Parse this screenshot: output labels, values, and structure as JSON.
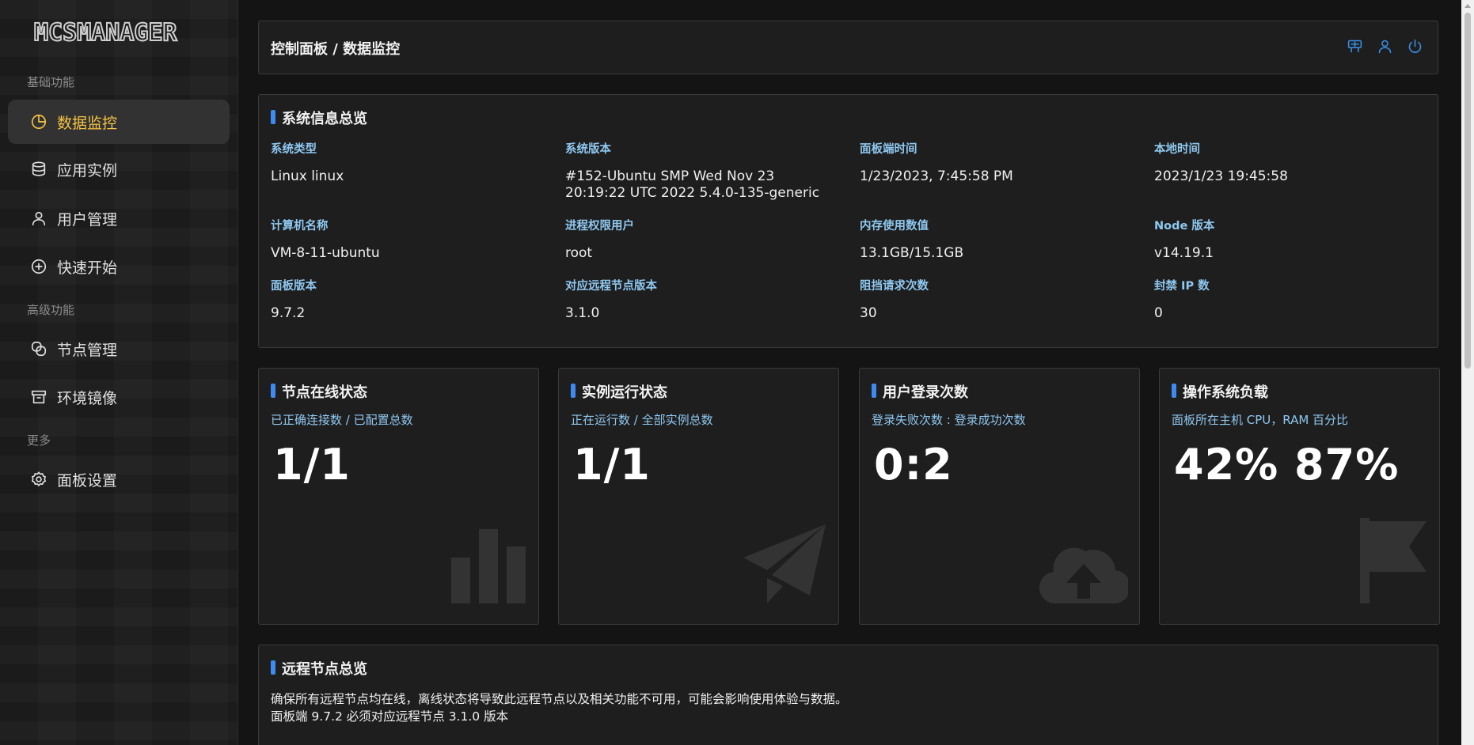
{
  "logo": "MCSMANAGER",
  "sidebar": {
    "groups": [
      {
        "title": "基础功能"
      },
      {
        "title": "高级功能"
      },
      {
        "title": "更多"
      }
    ],
    "items": [
      {
        "label": "数据监控",
        "icon": "pie-chart-icon",
        "active": true
      },
      {
        "label": "应用实例",
        "icon": "database-icon"
      },
      {
        "label": "用户管理",
        "icon": "user-icon"
      },
      {
        "label": "快速开始",
        "icon": "plus-circle-icon"
      },
      {
        "label": "节点管理",
        "icon": "node-link-icon"
      },
      {
        "label": "环境镜像",
        "icon": "archive-box-icon"
      },
      {
        "label": "面板设置",
        "icon": "gear-icon"
      }
    ]
  },
  "header": {
    "breadcrumb": "控制面板 / 数据监控",
    "icons": [
      "translate-icon",
      "user-icon",
      "power-icon"
    ]
  },
  "system": {
    "title": "系统信息总览",
    "fields": [
      {
        "label": "系统类型",
        "value": "Linux linux"
      },
      {
        "label": "系统版本",
        "value": "#152-Ubuntu SMP Wed Nov 23 20:19:22 UTC 2022 5.4.0-135-generic"
      },
      {
        "label": "面板端时间",
        "value": "1/23/2023, 7:45:58 PM"
      },
      {
        "label": "本地时间",
        "value": "2023/1/23 19:45:58"
      },
      {
        "label": "计算机名称",
        "value": "VM-8-11-ubuntu"
      },
      {
        "label": "进程权限用户",
        "value": "root"
      },
      {
        "label": "内存使用数值",
        "value": "13.1GB/15.1GB"
      },
      {
        "label": "Node 版本",
        "value": "v14.19.1"
      },
      {
        "label": "面板版本",
        "value": "9.7.2"
      },
      {
        "label": "对应远程节点版本",
        "value": "3.1.0"
      },
      {
        "label": "阻挡请求次数",
        "value": "30"
      },
      {
        "label": "封禁 IP 数",
        "value": "0"
      }
    ]
  },
  "stats": [
    {
      "title": "节点在线状态",
      "subtitle": "已正确连接数 / 已配置总数",
      "value": "1/1",
      "icon": "bar-chart-icon"
    },
    {
      "title": "实例运行状态",
      "subtitle": "正在运行数 / 全部实例总数",
      "value": "1/1",
      "icon": "paper-plane-icon"
    },
    {
      "title": "用户登录次数",
      "subtitle": "登录失败次数 : 登录成功次数",
      "value": "0:2",
      "icon": "cloud-upload-icon"
    },
    {
      "title": "操作系统负载",
      "subtitle": "面板所在主机 CPU，RAM 百分比",
      "value": "42% 87%",
      "icon": "flag-icon"
    }
  ],
  "remote": {
    "title": "远程节点总览",
    "line1": "确保所有远程节点均在线，离线状态将导致此远程节点以及相关功能不可用，可能会影响使用体验与数据。",
    "line2": "面板端 9.7.2 必须对应远程节点 3.1.0 版本"
  },
  "colors": {
    "accent": "#3d8bf0",
    "active_nav": "#f6c344",
    "label": "#8fc8f0"
  }
}
